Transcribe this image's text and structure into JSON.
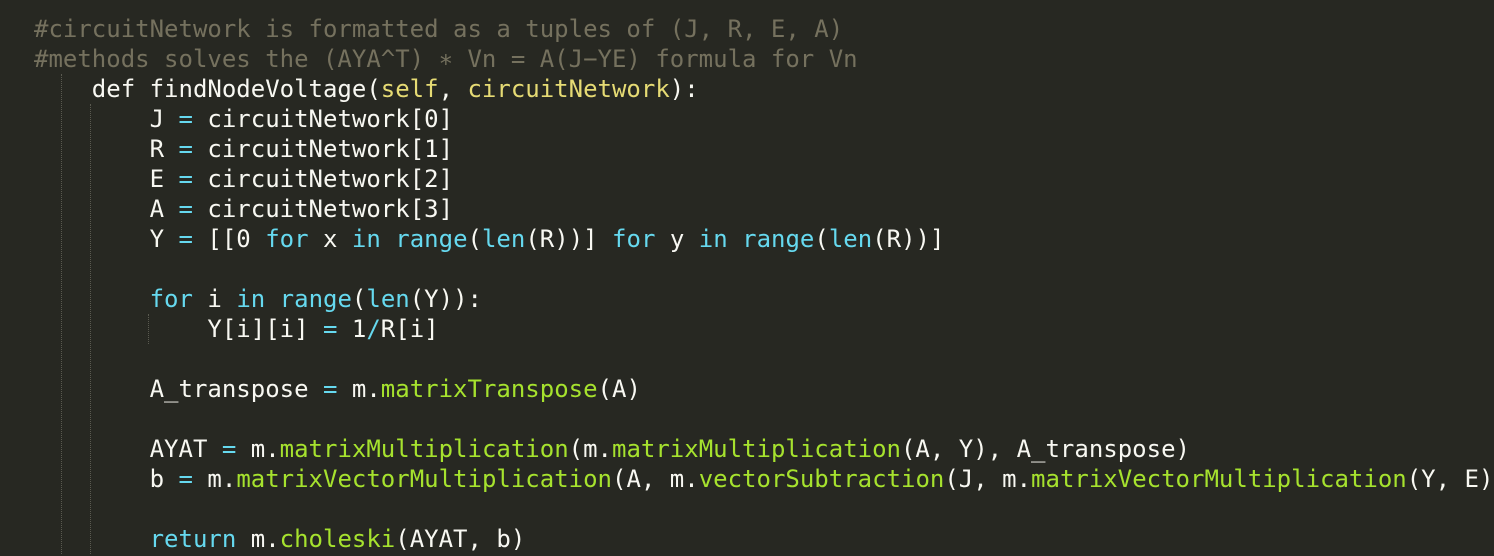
{
  "editor": {
    "background": "#272822",
    "colors": {
      "comment": "#75715e",
      "keyword": "#66d9ef",
      "function": "#a6e22e",
      "param": "#e6db74",
      "operator": "#66d9ef",
      "plain": "#f8f8f2"
    },
    "lines": [
      {
        "indent": 0,
        "tokens": [
          {
            "t": "comment",
            "v": "#circuitNetwork is formatted as a tuples of (J, R, E, A)"
          }
        ]
      },
      {
        "indent": 0,
        "tokens": [
          {
            "t": "comment",
            "v": "#methods solves the (AYA^T) ∗ Vn = A(J−YE) formula for Vn"
          }
        ]
      },
      {
        "indent": 1,
        "tokens": [
          {
            "t": "plain",
            "v": "def findNodeVoltage("
          },
          {
            "t": "param",
            "v": "self"
          },
          {
            "t": "plain",
            "v": ", "
          },
          {
            "t": "param",
            "v": "circuitNetwork"
          },
          {
            "t": "plain",
            "v": "):"
          }
        ]
      },
      {
        "indent": 2,
        "tokens": [
          {
            "t": "plain",
            "v": "J "
          },
          {
            "t": "op",
            "v": "="
          },
          {
            "t": "plain",
            "v": " circuitNetwork[0]"
          }
        ]
      },
      {
        "indent": 2,
        "tokens": [
          {
            "t": "plain",
            "v": "R "
          },
          {
            "t": "op",
            "v": "="
          },
          {
            "t": "plain",
            "v": " circuitNetwork[1]"
          }
        ]
      },
      {
        "indent": 2,
        "tokens": [
          {
            "t": "plain",
            "v": "E "
          },
          {
            "t": "op",
            "v": "="
          },
          {
            "t": "plain",
            "v": " circuitNetwork[2]"
          }
        ]
      },
      {
        "indent": 2,
        "tokens": [
          {
            "t": "plain",
            "v": "A "
          },
          {
            "t": "op",
            "v": "="
          },
          {
            "t": "plain",
            "v": " circuitNetwork[3]"
          }
        ]
      },
      {
        "indent": 2,
        "tokens": [
          {
            "t": "plain",
            "v": "Y "
          },
          {
            "t": "op",
            "v": "="
          },
          {
            "t": "plain",
            "v": " [[0 "
          },
          {
            "t": "kw",
            "v": "for"
          },
          {
            "t": "plain",
            "v": " x "
          },
          {
            "t": "kw",
            "v": "in"
          },
          {
            "t": "plain",
            "v": " "
          },
          {
            "t": "kw",
            "v": "range"
          },
          {
            "t": "plain",
            "v": "("
          },
          {
            "t": "kw",
            "v": "len"
          },
          {
            "t": "plain",
            "v": "(R))] "
          },
          {
            "t": "kw",
            "v": "for"
          },
          {
            "t": "plain",
            "v": " y "
          },
          {
            "t": "kw",
            "v": "in"
          },
          {
            "t": "plain",
            "v": " "
          },
          {
            "t": "kw",
            "v": "range"
          },
          {
            "t": "plain",
            "v": "("
          },
          {
            "t": "kw",
            "v": "len"
          },
          {
            "t": "plain",
            "v": "(R))]"
          }
        ]
      },
      {
        "indent": 2,
        "tokens": []
      },
      {
        "indent": 2,
        "tokens": [
          {
            "t": "kw",
            "v": "for"
          },
          {
            "t": "plain",
            "v": " i "
          },
          {
            "t": "kw",
            "v": "in"
          },
          {
            "t": "plain",
            "v": " "
          },
          {
            "t": "kw",
            "v": "range"
          },
          {
            "t": "plain",
            "v": "("
          },
          {
            "t": "kw",
            "v": "len"
          },
          {
            "t": "plain",
            "v": "(Y)):"
          }
        ]
      },
      {
        "indent": 3,
        "tokens": [
          {
            "t": "plain",
            "v": "Y[i][i] "
          },
          {
            "t": "op",
            "v": "="
          },
          {
            "t": "plain",
            "v": " 1"
          },
          {
            "t": "op",
            "v": "/"
          },
          {
            "t": "plain",
            "v": "R[i]"
          }
        ]
      },
      {
        "indent": 2,
        "tokens": []
      },
      {
        "indent": 2,
        "tokens": [
          {
            "t": "plain",
            "v": "A_transpose "
          },
          {
            "t": "op",
            "v": "="
          },
          {
            "t": "plain",
            "v": " m."
          },
          {
            "t": "fn",
            "v": "matrixTranspose"
          },
          {
            "t": "plain",
            "v": "(A)"
          }
        ]
      },
      {
        "indent": 2,
        "tokens": []
      },
      {
        "indent": 2,
        "tokens": [
          {
            "t": "plain",
            "v": "AYAT "
          },
          {
            "t": "op",
            "v": "="
          },
          {
            "t": "plain",
            "v": " m."
          },
          {
            "t": "fn",
            "v": "matrixMultiplication"
          },
          {
            "t": "plain",
            "v": "(m."
          },
          {
            "t": "fn",
            "v": "matrixMultiplication"
          },
          {
            "t": "plain",
            "v": "(A, Y), A_transpose)"
          }
        ]
      },
      {
        "indent": 2,
        "tokens": [
          {
            "t": "plain",
            "v": "b "
          },
          {
            "t": "op",
            "v": "="
          },
          {
            "t": "plain",
            "v": " m."
          },
          {
            "t": "fn",
            "v": "matrixVectorMultiplication"
          },
          {
            "t": "plain",
            "v": "(A, m."
          },
          {
            "t": "fn",
            "v": "vectorSubtraction"
          },
          {
            "t": "plain",
            "v": "(J, m."
          },
          {
            "t": "fn",
            "v": "matrixVectorMultiplication"
          },
          {
            "t": "plain",
            "v": "(Y, E)))"
          }
        ]
      },
      {
        "indent": 2,
        "tokens": []
      },
      {
        "indent": 2,
        "tokens": [
          {
            "t": "kw",
            "v": "return"
          },
          {
            "t": "plain",
            "v": " m."
          },
          {
            "t": "fn",
            "v": "choleski"
          },
          {
            "t": "plain",
            "v": "(AYAT, b)"
          }
        ]
      }
    ]
  }
}
